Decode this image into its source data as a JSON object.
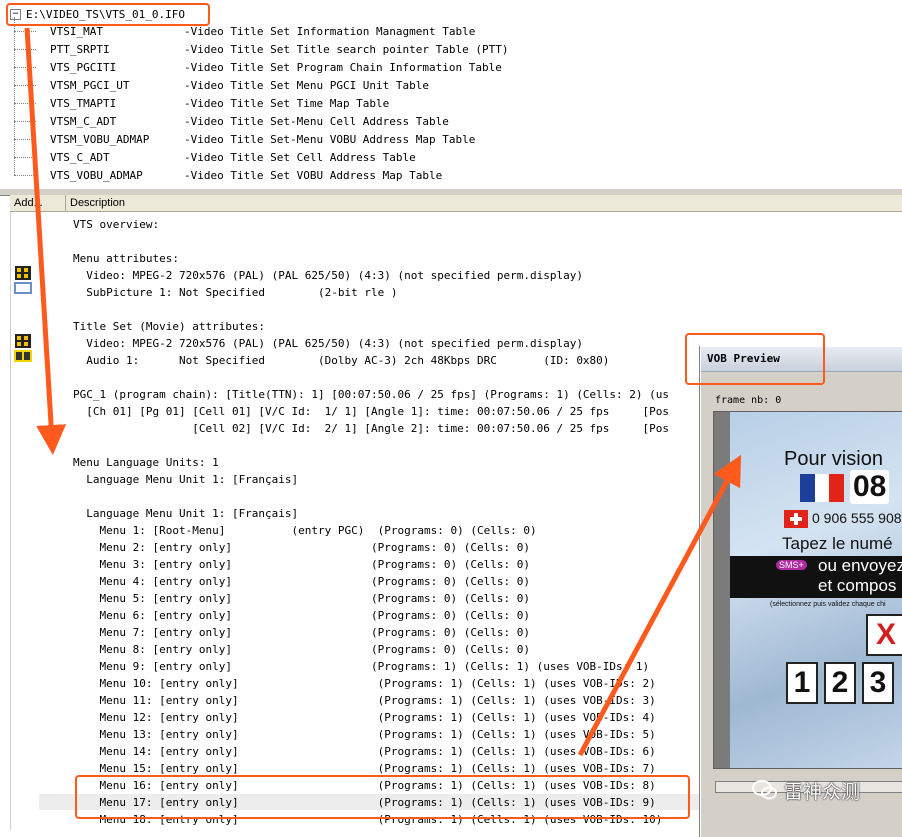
{
  "tree": {
    "root_path": "E:\\VIDEO_TS\\VTS_01_0.IFO",
    "expander": "−",
    "items": [
      {
        "name": "VTSI_MAT",
        "desc": "-Video Title Set Information Managment Table"
      },
      {
        "name": "PTT_SRPTI",
        "desc": "-Video Title Set Title search pointer Table (PTT)"
      },
      {
        "name": "VTS_PGCITI",
        "desc": "-Video Title Set Program Chain Information Table"
      },
      {
        "name": "VTSM_PGCI_UT",
        "desc": "-Video Title Set Menu PGCI Unit Table"
      },
      {
        "name": "VTS_TMAPTI",
        "desc": "-Video Title Set Time Map Table"
      },
      {
        "name": "VTSM_C_ADT",
        "desc": "-Video Title Set-Menu Cell Address Table"
      },
      {
        "name": "VTSM_VOBU_ADMAP",
        "desc": "-Video Title Set-Menu VOBU Address Map Table"
      },
      {
        "name": "VTS_C_ADT",
        "desc": "-Video Title Set Cell Address Table"
      },
      {
        "name": "VTS_VOBU_ADMAP",
        "desc": "-Video Title Set VOBU Address Map Table"
      }
    ]
  },
  "list": {
    "columns": [
      "Add...",
      "Description"
    ],
    "lines": [
      "VTS overview:",
      "",
      "Menu attributes:",
      "  Video: MPEG-2 720x576 (PAL) (PAL 625/50) (4:3) (not specified perm.display)",
      "  SubPicture 1: Not Specified        (2-bit rle )",
      "",
      "Title Set (Movie) attributes:",
      "  Video: MPEG-2 720x576 (PAL) (PAL 625/50) (4:3) (not specified perm.display)",
      "  Audio 1:      Not Specified        (Dolby AC-3) 2ch 48Kbps DRC       (ID: 0x80)",
      "",
      "PGC_1 (program chain): [Title(TTN): 1] [00:07:50.06 / 25 fps] (Programs: 1) (Cells: 2) (us",
      "  [Ch 01] [Pg 01] [Cell 01] [V/C Id:  1/ 1] [Angle 1]: time: 00:07:50.06 / 25 fps     [Pos",
      "                  [Cell 02] [V/C Id:  2/ 1] [Angle 2]: time: 00:07:50.06 / 25 fps     [Pos",
      "",
      "Menu Language Units: 1",
      "  Language Menu Unit 1: [Français]",
      "",
      "  Language Menu Unit 1: [Français]",
      "    Menu 1: [Root-Menu]          (entry PGC)  (Programs: 0) (Cells: 0)",
      "    Menu 2: [entry only]                     (Programs: 0) (Cells: 0)",
      "    Menu 3: [entry only]                     (Programs: 0) (Cells: 0)",
      "    Menu 4: [entry only]                     (Programs: 0) (Cells: 0)",
      "    Menu 5: [entry only]                     (Programs: 0) (Cells: 0)",
      "    Menu 6: [entry only]                     (Programs: 0) (Cells: 0)",
      "    Menu 7: [entry only]                     (Programs: 0) (Cells: 0)",
      "    Menu 8: [entry only]                     (Programs: 0) (Cells: 0)",
      "    Menu 9: [entry only]                     (Programs: 1) (Cells: 1) (uses VOB-IDs: 1)",
      "    Menu 10: [entry only]                     (Programs: 1) (Cells: 1) (uses VOB-IDs: 2)",
      "    Menu 11: [entry only]                     (Programs: 1) (Cells: 1) (uses VOB-IDs: 3)",
      "    Menu 12: [entry only]                     (Programs: 1) (Cells: 1) (uses VOB-IDs: 4)",
      "    Menu 13: [entry only]                     (Programs: 1) (Cells: 1) (uses VOB-IDs: 5)",
      "    Menu 14: [entry only]                     (Programs: 1) (Cells: 1) (uses VOB-IDs: 6)",
      "    Menu 15: [entry only]                     (Programs: 1) (Cells: 1) (uses VOB-IDs: 7)",
      "    Menu 16: [entry only]                     (Programs: 1) (Cells: 1) (uses VOB-IDs: 8)",
      "    Menu 17: [entry only]                     (Programs: 1) (Cells: 1) (uses VOB-IDs: 9)",
      "    Menu 18: [entry only]                     (Programs: 1) (Cells: 1) (uses VOB-IDs: 10)"
    ]
  },
  "vob_preview": {
    "title": "VOB Preview",
    "frame_label": "frame nb: 0",
    "screen": {
      "line1": "Pour vision",
      "line2": "08",
      "line3": "0 906 555 908",
      "line4": "Tapez le numé",
      "line5_badge": "SMS+",
      "line5": "ou envoyez",
      "line6": "et compos",
      "line7": "(sélectionnez puis validez chaque chi",
      "x_mark": "X",
      "digits": [
        "1",
        "2",
        "3"
      ]
    }
  },
  "watermark": {
    "text": "雷神众测"
  },
  "colors": {
    "annotation": "#ff5a1e",
    "dialog_bg": "#d4d0c8",
    "highlight_row": "#ededed"
  }
}
